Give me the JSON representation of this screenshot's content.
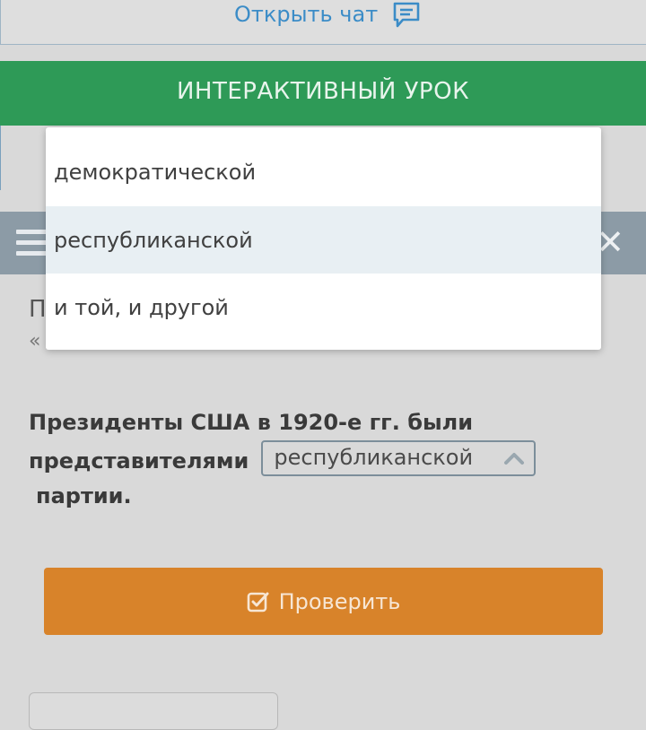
{
  "header": {
    "chat_label": "Открыть чат",
    "chat_icon": "chat-icon"
  },
  "lesson_bar": {
    "title": "ИНТЕРАКТИВНЫЙ УРОК"
  },
  "toolbar": {
    "menu_icon": "hamburger-icon",
    "close_icon": "close-icon"
  },
  "task": {
    "hidden_text_1": "П",
    "hidden_text_2": "«"
  },
  "question": {
    "text_line1": "Президенты США в 1920-е гг. были",
    "text_before_select": "представителями",
    "text_after_select": "партии.",
    "selected_value": "республиканской"
  },
  "dropdown": {
    "options": [
      {
        "label": "демократической"
      },
      {
        "label": "республиканской"
      },
      {
        "label": "и той, и другой"
      }
    ]
  },
  "check_button": {
    "label": "Проверить",
    "icon": "checkbox-icon"
  },
  "colors": {
    "green_bar": "#2e9a57",
    "slate_bar": "#8c9ba6",
    "check_button": "#d8832a",
    "link": "#3b8cc7"
  }
}
